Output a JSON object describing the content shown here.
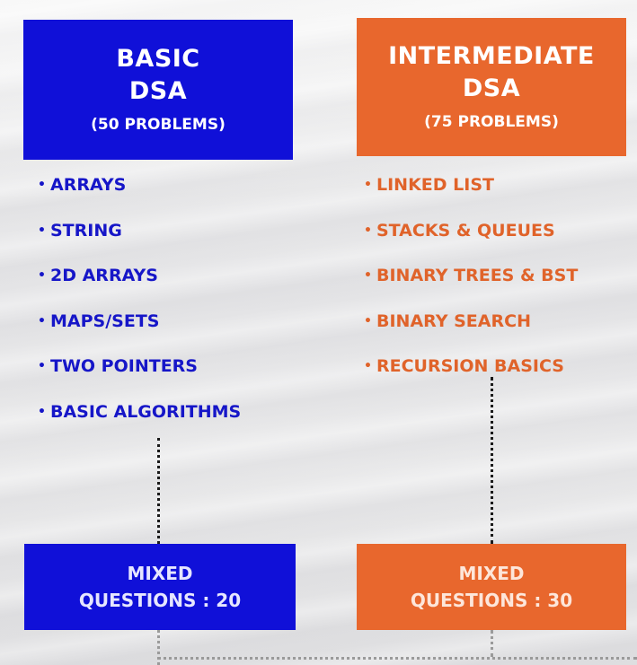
{
  "basic": {
    "title_line1": "BASIC",
    "title_line2": "DSA",
    "count": "(50 PROBLEMS)",
    "bullet": "•",
    "topics": [
      "ARRAYS",
      "STRING",
      "2D ARRAYS",
      "MAPS/SETS",
      "TWO POINTERS",
      "BASIC ALGORITHMS"
    ],
    "mixed_line1": "MIXED",
    "mixed_line2": "QUESTIONS : 20",
    "color": "#1010d8"
  },
  "intermediate": {
    "title_line1": "INTERMEDIATE",
    "title_line2": "DSA",
    "count": "(75 PROBLEMS)",
    "bullet": "•",
    "topics": [
      "LINKED LIST",
      "STACKS & QUEUES",
      "BINARY TREES & BST",
      "BINARY SEARCH",
      "RECURSION BASICS"
    ],
    "mixed_line1": "MIXED",
    "mixed_line2": "QUESTIONS : 30",
    "color": "#e8672d"
  }
}
